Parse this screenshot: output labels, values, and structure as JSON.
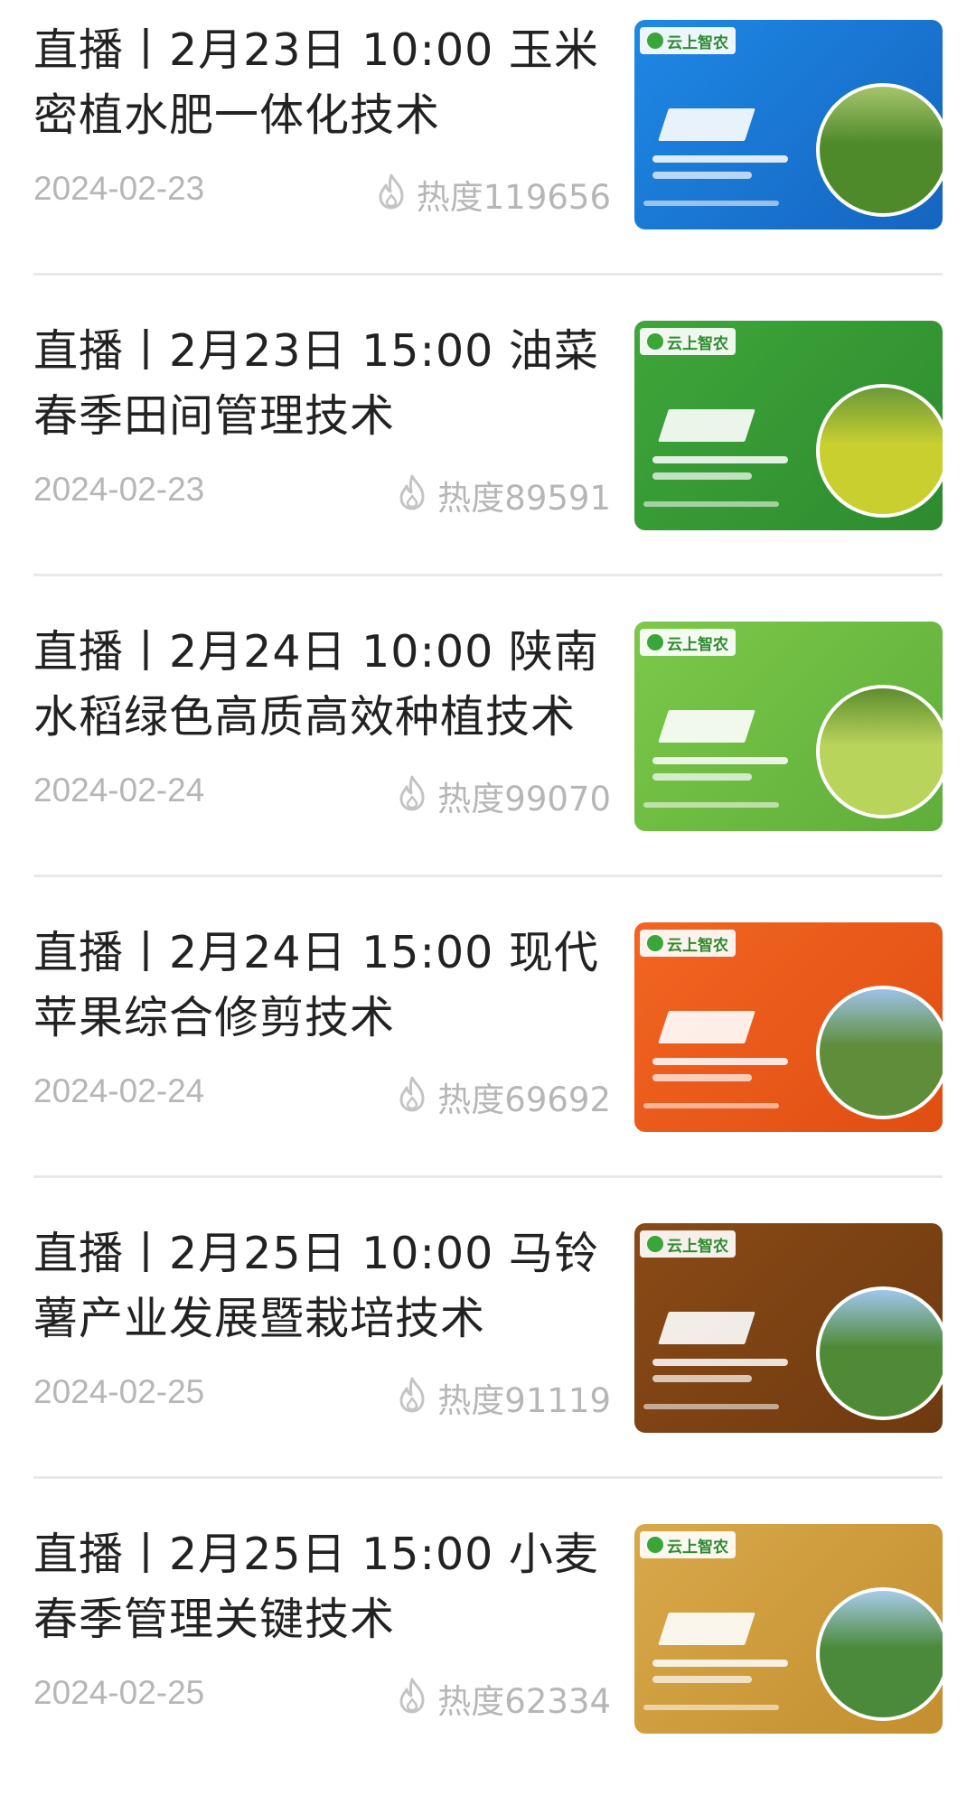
{
  "items": [
    {
      "title": "直播丨2月23日 10:00 玉米密植水肥一体化技术",
      "date": "2024-02-23",
      "heat": "热度119656",
      "thumb": {
        "bg": "#1e88e5",
        "bg2": "#1565c0",
        "circle": "#4f8a2a",
        "circle2": "#a6c46c"
      }
    },
    {
      "title": "直播丨2月23日 15:00 油菜春季田间管理技术",
      "date": "2024-02-23",
      "heat": "热度89591",
      "thumb": {
        "bg": "#3ea63a",
        "bg2": "#2e8b2e",
        "circle": "#c9cf2f",
        "circle2": "#6a9a3a"
      }
    },
    {
      "title": "直播丨2月24日 10:00 陕南水稻绿色高质高效种植技术",
      "date": "2024-02-24",
      "heat": "热度99070",
      "thumb": {
        "bg": "#7cc84a",
        "bg2": "#5fae3a",
        "circle": "#b9d45a",
        "circle2": "#5d8d2f"
      }
    },
    {
      "title": "直播丨2月24日 15:00 现代苹果综合修剪技术",
      "date": "2024-02-24",
      "heat": "热度69692",
      "thumb": {
        "bg": "#f26522",
        "bg2": "#e04e12",
        "circle": "#5f8d3a",
        "circle2": "#9cc2e6"
      }
    },
    {
      "title": "直播丨2月25日 10:00 马铃薯产业发展暨栽培技术",
      "date": "2024-02-25",
      "heat": "热度91119",
      "thumb": {
        "bg": "#8a4a16",
        "bg2": "#6e3a10",
        "circle": "#4f8a36",
        "circle2": "#9fc6ec"
      }
    },
    {
      "title": "直播丨2月25日 15:00 小麦春季管理关键技术",
      "date": "2024-02-25",
      "heat": "热度62334",
      "thumb": {
        "bg": "#d8a84a",
        "bg2": "#c38f2f",
        "circle": "#4a8a3a",
        "circle2": "#a8cbe8"
      }
    }
  ],
  "thumb_common": {
    "brand": "云上智农"
  }
}
